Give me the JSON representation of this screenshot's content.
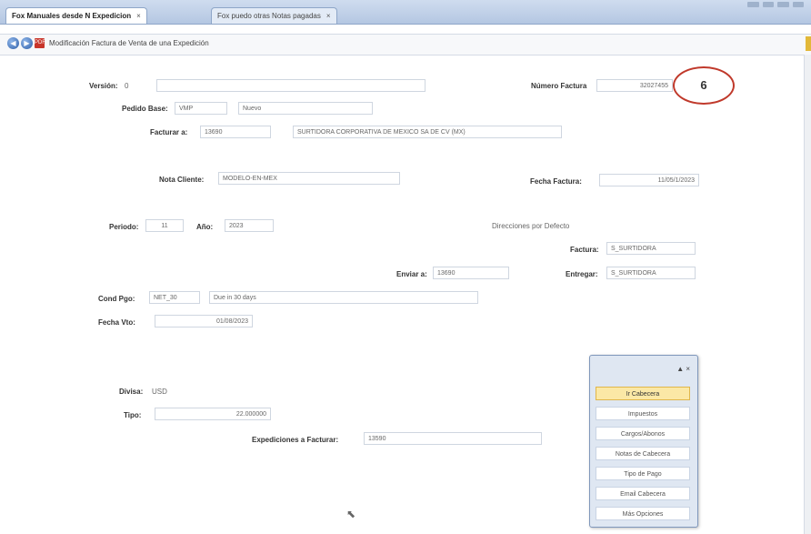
{
  "tabs": [
    {
      "label": "Fox Manuales desde N Expedicion"
    },
    {
      "label": "Fox puedo otras Notas pagadas"
    }
  ],
  "tab_close": "×",
  "nav": {
    "back": "◀",
    "forward": "▶",
    "pdf": "PDF",
    "title": "Modificación Factura de Venta de una Expedición"
  },
  "form": {
    "version_label": "Versión:",
    "version_value": "0",
    "numero_factura_label": "Número Factura",
    "numero_factura_value": "32027455",
    "step_number": "6",
    "pedido_base_label": "Pedido Base:",
    "pedido_base_code": "VMP",
    "pedido_base_name": "Nuevo",
    "facturar_a_label": "Facturar a:",
    "facturar_a_code": "13690",
    "facturar_a_name": "SURTIDORA CORPORATIVA DE MEXICO SA DE CV (MX)",
    "nota_cliente_label": "Nota Cliente:",
    "nota_cliente_value": "MODELO-EN-MEX",
    "fecha_factura_label": "Fecha Factura:",
    "fecha_factura_value": "11/05/1/2023",
    "periodo_label": "Periodo:",
    "periodo_value": "11",
    "ano_label": "Año:",
    "ano_value": "2023",
    "direcciones_label": "Direcciones por Defecto",
    "factura_label": "Factura:",
    "factura_value": "S_SURTIDORA",
    "enviar_a_label": "Enviar a:",
    "enviar_a_value": "13690",
    "entregar_label": "Entregar:",
    "entregar_value": "S_SURTIDORA",
    "cond_pgo_label": "Cond Pgo:",
    "cond_pgo_code": "NET_30",
    "cond_pgo_name": "Due in 30 days",
    "fecha_vto_label": "Fecha Vto:",
    "fecha_vto_value": "01/08/2023",
    "divisa_label": "Divisa:",
    "divisa_value": "USD",
    "tipo_label": "Tipo:",
    "tipo_value": "22.000000",
    "expediciones_label": "Expediciones a Facturar:",
    "expediciones_value": "13590"
  },
  "popup": {
    "controls": "▲ ×",
    "items": [
      "Ir Cabecera",
      "Impuestos",
      "Cargos/Abonos",
      "Notas de Cabecera",
      "Tipo de Pago",
      "Email Cabecera",
      "Más Opciones"
    ],
    "selected_index": 0
  },
  "colors": {
    "tab_bg": "#b4c7e2",
    "highlight": "#fbe8a6",
    "annotation_circle": "#c0392b"
  },
  "icons": {
    "back": "back-arrow-icon",
    "forward": "forward-arrow-icon",
    "pdf": "pdf-icon",
    "cursor": "mouse-cursor-icon"
  },
  "cursor_glyph": "⬉"
}
